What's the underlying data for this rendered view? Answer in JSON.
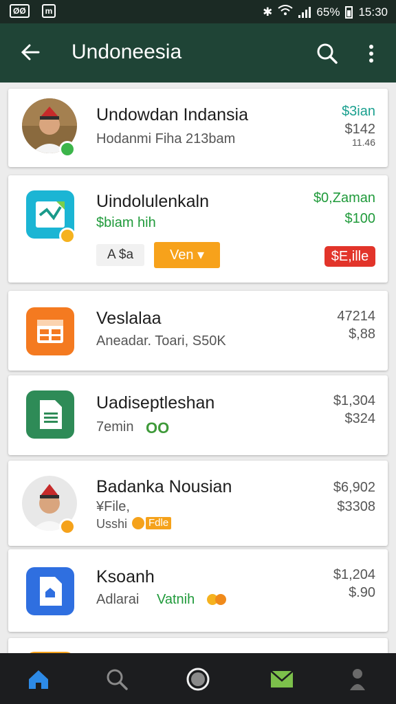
{
  "status_bar": {
    "left_badge_1": "ØØ",
    "left_badge_2": "m",
    "battery": "65%",
    "time": "15:30"
  },
  "app_bar": {
    "title": "Undoneesia"
  },
  "items": [
    {
      "name": "Undowdan Indansia",
      "sub": "Hodanmi Fiha 213bam",
      "amount_1": "$3ian",
      "amount_2": "$142",
      "amount_3": "11.46"
    },
    {
      "name": "Uindolulenkaln",
      "sub": "$biam hih",
      "amount_1": "$0,Zaman",
      "amount_2": "$100",
      "pill": "A $a",
      "button": "Ven ▾",
      "chip": "$E,ille"
    },
    {
      "name": "Veslalaa",
      "sub": "Aneadar. Toari, S50K",
      "amount_1": "47214",
      "amount_2": "$,88"
    },
    {
      "name": "Uadiseptleshan",
      "sub": "7emin",
      "amount_1": "$1,304",
      "amount_2": "$324"
    },
    {
      "name": "Badanka Nousian",
      "sub": "¥File,",
      "sub_2": "Usshi",
      "tag": "Fdle",
      "amount_1": "$6,902",
      "amount_2": "$3308"
    },
    {
      "name": "Ksoanh",
      "sub": "Adlarai",
      "sub_green": "Vatnih",
      "amount_1": "$1,204",
      "amount_2": "$.90"
    }
  ],
  "nav": {
    "home": "home",
    "search": "search",
    "circle": "circle",
    "mail": "mail",
    "profile": "profile"
  }
}
